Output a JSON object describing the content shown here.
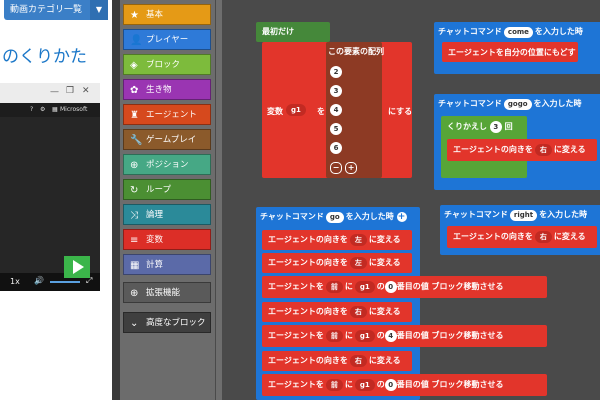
{
  "left_page": {
    "category_button": "動画カテゴリ一覧",
    "title": "のくりかた",
    "window_labels": {
      "microsoft": "Microsoft",
      "zoom": "1x"
    }
  },
  "toolbox": {
    "categories": [
      {
        "label": "基本",
        "icon": "star-icon",
        "color": "#e59a16"
      },
      {
        "label": "プレイヤー",
        "icon": "person-icon",
        "color": "#2e7ad8"
      },
      {
        "label": "ブロック",
        "icon": "cube-icon",
        "color": "#7dbb3c"
      },
      {
        "label": "生き物",
        "icon": "paw-icon",
        "color": "#9a35b2"
      },
      {
        "label": "エージェント",
        "icon": "agent-icon",
        "color": "#d6491d"
      },
      {
        "label": "ゲームプレイ",
        "icon": "wrench-icon",
        "color": "#8b5a2b"
      },
      {
        "label": "ポジション",
        "icon": "crosshair-icon",
        "color": "#46a885"
      },
      {
        "label": "ループ",
        "icon": "loop-icon",
        "color": "#4b8f33"
      },
      {
        "label": "論理",
        "icon": "shuffle-icon",
        "color": "#2b8a99"
      },
      {
        "label": "変数",
        "icon": "list-icon",
        "color": "#dc2e27"
      },
      {
        "label": "計算",
        "icon": "calculator-icon",
        "color": "#5b6aa8"
      },
      {
        "label": "拡張機能",
        "icon": "plus-circle-icon",
        "color": "#5a5a5a"
      },
      {
        "label": "高度なブロック",
        "icon": "chevron-down-icon",
        "color": "#3f3f3f"
      }
    ]
  },
  "workspace": {
    "on_start": {
      "header": "最初だけ",
      "set_label": "変数",
      "var": "g1",
      "to": "を",
      "array_label": "この要素の配列",
      "array_values": [
        "2",
        "3",
        "4",
        "5",
        "6"
      ],
      "suffix": "にする"
    },
    "chat_come": {
      "prefix": "チャットコマンド",
      "command": "come",
      "suffix": "を入力した時",
      "body": "エージェントを自分の位置にもどす"
    },
    "chat_gogo": {
      "prefix": "チャットコマンド",
      "command": "gogo",
      "suffix": "を入力した時",
      "repeat_label": "くりかえし",
      "repeat_count": "3",
      "repeat_unit": "回",
      "body_prefix": "エージェントの向きを",
      "body_dir": "右",
      "body_suffix": "に変える"
    },
    "chat_right": {
      "prefix": "チャットコマンド",
      "command": "right",
      "suffix": "を入力した時",
      "body_prefix": "エージェントの向きを",
      "body_dir": "右",
      "body_suffix": "に変える"
    },
    "chat_go": {
      "prefix": "チャットコマンド",
      "command": "go",
      "suffix": "を入力した時",
      "turn_prefix": "エージェントの向きを",
      "turn_suffix": "に変える",
      "move_prefix": "エージェントを",
      "move_dir": "前",
      "move_ni": "に",
      "move_no": "の",
      "move_index_suffix": "番目の値",
      "move_suffix": "ブロック移動させる",
      "var": "g1",
      "rows": [
        {
          "kind": "turn",
          "dir": "左"
        },
        {
          "kind": "turn",
          "dir": "左"
        },
        {
          "kind": "move",
          "index": "0"
        },
        {
          "kind": "turn",
          "dir": "右"
        },
        {
          "kind": "move",
          "index": "4"
        },
        {
          "kind": "turn",
          "dir": "右"
        },
        {
          "kind": "move",
          "index": "0"
        }
      ]
    }
  }
}
